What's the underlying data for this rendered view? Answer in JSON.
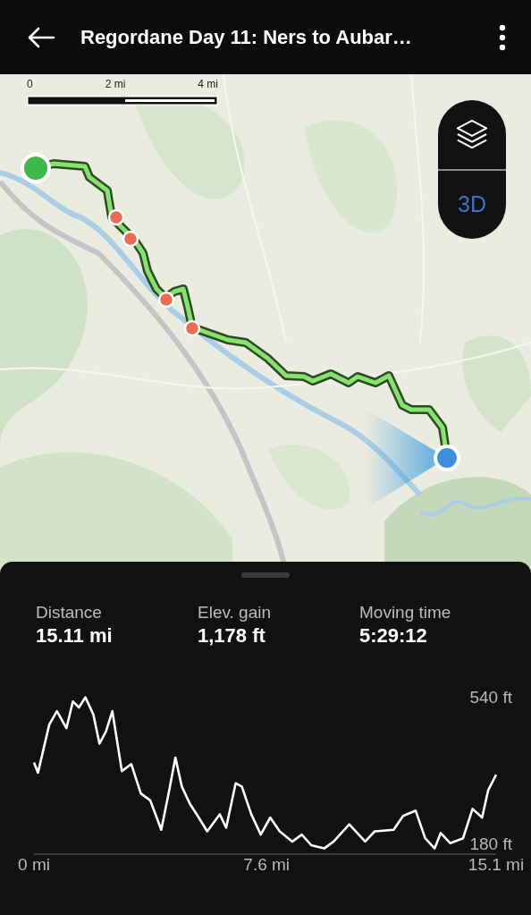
{
  "header": {
    "title": "Regordane Day 11: Ners to Aubar…"
  },
  "map": {
    "scale": {
      "labels": [
        "0",
        "2 mi",
        "4 mi"
      ]
    },
    "layers_button": {
      "label": "3D"
    }
  },
  "stats": [
    {
      "label": "Distance",
      "value": "15.11 mi"
    },
    {
      "label": "Elev. gain",
      "value": "1,178 ft"
    },
    {
      "label": "Moving time",
      "value": "5:29:12"
    }
  ],
  "elevation": {
    "chart_data": {
      "type": "line",
      "x": [
        0,
        0.13,
        0.5,
        0.75,
        1.06,
        1.27,
        1.47,
        1.68,
        1.94,
        2.14,
        2.35,
        2.56,
        2.87,
        3.18,
        3.49,
        3.8,
        4.16,
        4.42,
        4.62,
        4.83,
        5.09,
        5.35,
        5.66,
        6.07,
        6.28,
        6.59,
        6.79,
        7.1,
        7.41,
        7.72,
        8.03,
        8.44,
        8.75,
        9.06,
        9.48,
        9.79,
        10.3,
        10.82,
        11.13,
        11.75,
        12.06,
        12.47,
        12.78,
        13.09,
        13.29,
        13.6,
        14.02,
        14.33,
        14.64,
        14.84,
        15.1
      ],
      "series": [
        {
          "color": "#ffffff",
          "values": [
            380,
            355,
            473,
            506,
            464,
            530,
            515,
            540,
            498,
            426,
            456,
            506,
            359,
            376,
            304,
            287,
            215,
            312,
            392,
            321,
            279,
            249,
            211,
            253,
            220,
            329,
            321,
            253,
            203,
            245,
            211,
            186,
            203,
            177,
            169,
            186,
            228,
            186,
            211,
            215,
            249,
            262,
            194,
            169,
            207,
            182,
            194,
            266,
            245,
            312,
            350
          ]
        }
      ],
      "xlim": [
        0,
        15.1
      ],
      "ylim": [
        155,
        540
      ],
      "xticks": [
        {
          "value": 0,
          "label": "0 mi"
        },
        {
          "value": 7.6,
          "label": "7.6 mi"
        },
        {
          "value": 15.1,
          "label": "15.1 mi"
        }
      ],
      "yticks": [
        {
          "value": 540,
          "label": "540 ft"
        },
        {
          "value": 180,
          "label": "180 ft"
        }
      ]
    }
  }
}
